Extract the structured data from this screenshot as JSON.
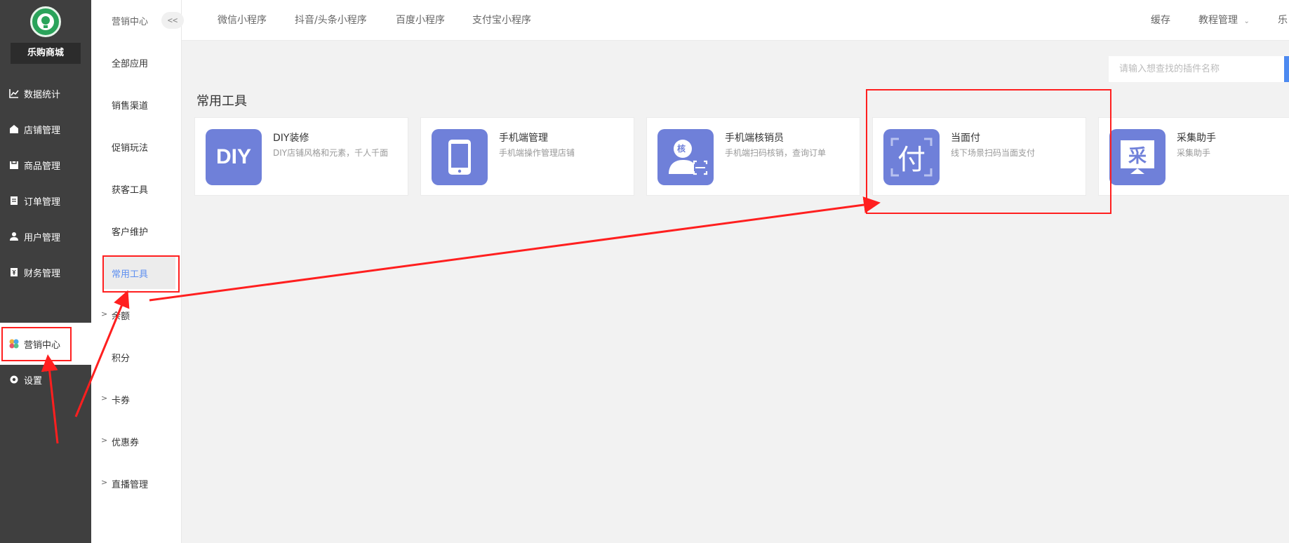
{
  "sidebar": {
    "shop_name": "乐购商城",
    "items": [
      {
        "label": "数据统计",
        "icon": "chart-line-icon"
      },
      {
        "label": "店铺管理",
        "icon": "store-icon"
      },
      {
        "label": "商品管理",
        "icon": "goods-icon"
      },
      {
        "label": "订单管理",
        "icon": "order-icon"
      },
      {
        "label": "用户管理",
        "icon": "user-icon"
      },
      {
        "label": "财务管理",
        "icon": "finance-icon"
      },
      {
        "label": "营销中心",
        "icon": "marketing-icon",
        "active": true
      },
      {
        "label": "设置",
        "icon": "gear-icon"
      }
    ]
  },
  "subnav": {
    "title": "营销中心",
    "collapse_label": "<<",
    "items": [
      {
        "label": "全部应用"
      },
      {
        "label": "销售渠道"
      },
      {
        "label": "促销玩法"
      },
      {
        "label": "获客工具"
      },
      {
        "label": "客户维护"
      },
      {
        "label": "常用工具",
        "active": true
      },
      {
        "label": "余额",
        "expandable": true
      },
      {
        "label": "积分"
      },
      {
        "label": "卡券",
        "expandable": true
      },
      {
        "label": "优惠券",
        "expandable": true
      },
      {
        "label": "直播管理",
        "expandable": true
      }
    ]
  },
  "topbar": {
    "tabs": [
      "微信小程序",
      "抖音/头条小程序",
      "百度小程序",
      "支付宝小程序"
    ],
    "cache": "缓存",
    "tutorial": "教程管理",
    "user_partial": "乐"
  },
  "search": {
    "placeholder": "请输入想查找的插件名称"
  },
  "section_title": "常用工具",
  "cards": [
    {
      "name": "DIY装修",
      "desc": "DIY店铺风格和元素，千人千面",
      "icon_text": "DIY",
      "icon": "diy-icon"
    },
    {
      "name": "手机端管理",
      "desc": "手机端操作管理店铺",
      "icon_text": "",
      "icon": "phone-icon"
    },
    {
      "name": "手机端核销员",
      "desc": "手机端扫码核销，查询订单",
      "icon_text": "核",
      "icon": "verify-user-icon"
    },
    {
      "name": "当面付",
      "desc": "线下场景扫码当面支付",
      "icon_text": "付",
      "icon": "pay-icon"
    },
    {
      "name": "采集助手",
      "desc": "采集助手",
      "icon_text": "采",
      "icon": "collect-icon"
    }
  ],
  "colors": {
    "sidebar_bg": "#3f3f3f",
    "icon_bg": "#6f80d9",
    "active_text": "#5e8ff0",
    "annotation": "#ff1f1f"
  }
}
